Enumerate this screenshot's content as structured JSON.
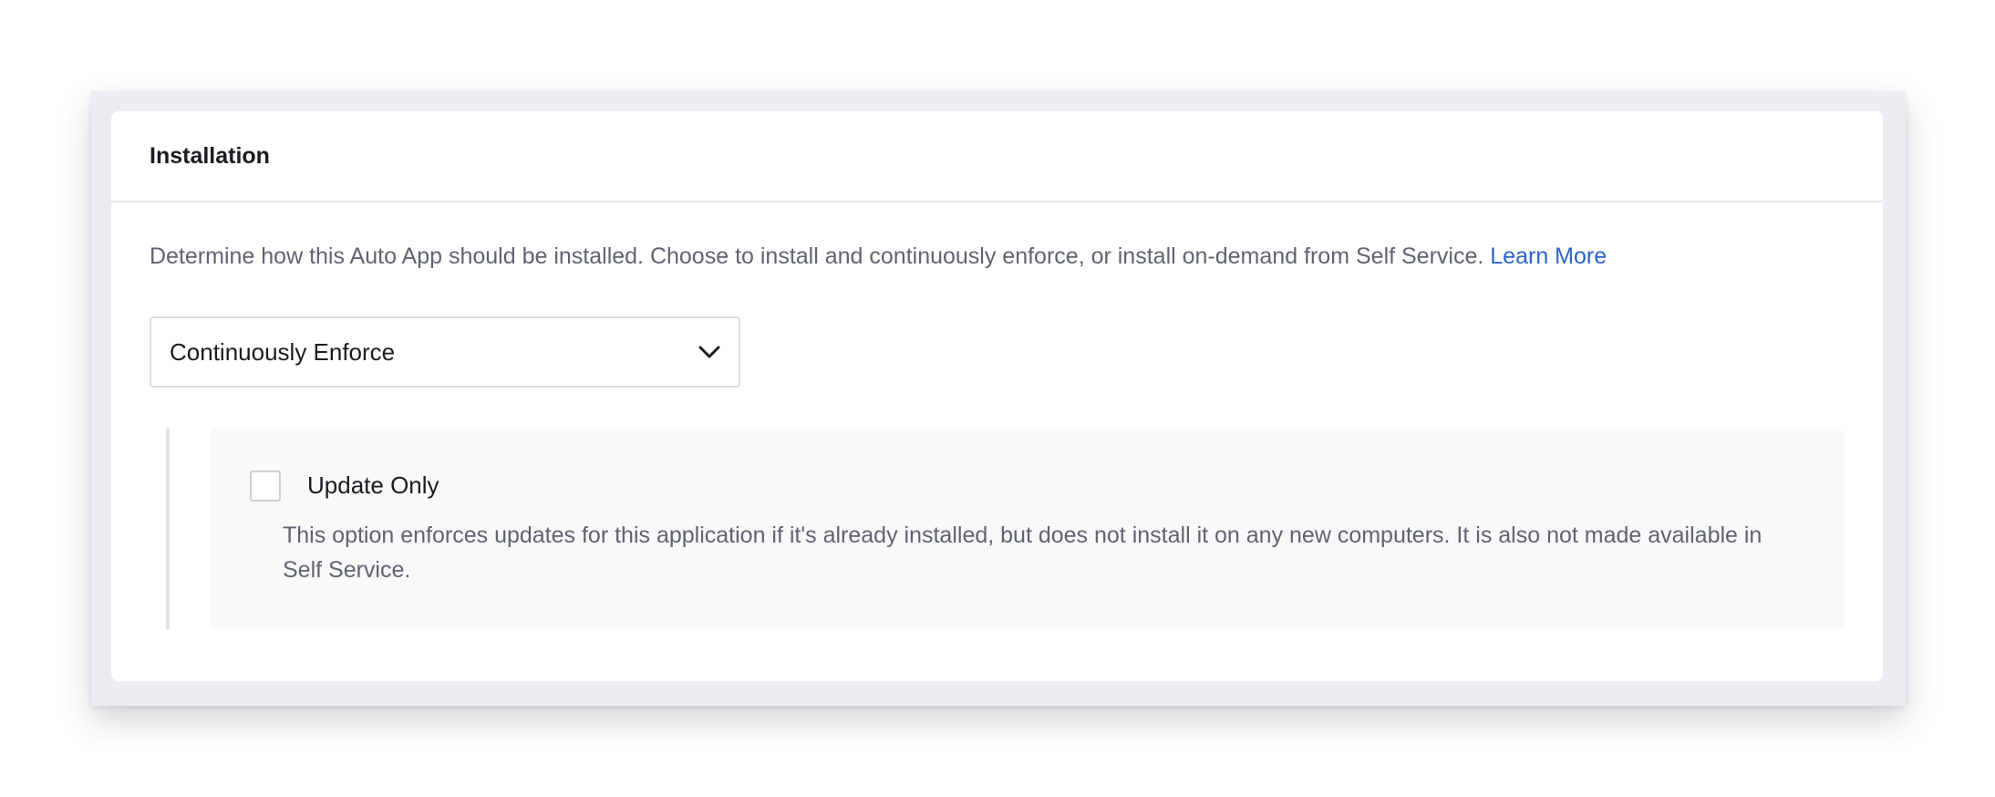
{
  "installation": {
    "title": "Installation",
    "description": "Determine how this Auto App should be installed. Choose to install and continuously enforce, or install on-demand from Self Service.",
    "learn_more_label": "Learn More",
    "install_method": {
      "selected": "Continuously Enforce",
      "icon": "chevron-down-icon"
    },
    "update_only": {
      "label": "Update Only",
      "checked": false,
      "help_text": "This option enforces updates for this application if it's already installed, but does not install it on any new computers. It is also not made available in Self Service."
    }
  },
  "colors": {
    "link": "#2b64c7",
    "outer_background": "#ecedf2",
    "panel_background": "#f9f9fa",
    "text_secondary": "#5f6470"
  }
}
